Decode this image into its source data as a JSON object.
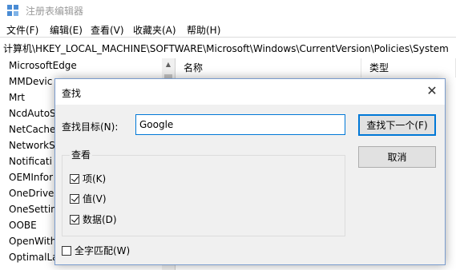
{
  "window": {
    "title": "注册表编辑器"
  },
  "menu": [
    "文件(F)",
    "编辑(E)",
    "查看(V)",
    "收藏夹(A)",
    "帮助(H)"
  ],
  "address": "计算机\\HKEY_LOCAL_MACHINE\\SOFTWARE\\Microsoft\\Windows\\CurrentVersion\\Policies\\System",
  "tree": {
    "items": [
      "MicrosoftEdge",
      "MMDevic",
      "Mrt",
      "NcdAutoS",
      "NetCache",
      "NetworkS",
      "Notificati",
      "OEMInfor",
      "OneDrive",
      "OneSettin",
      "OOBE",
      "OpenWith",
      "OptimalLa"
    ]
  },
  "values": {
    "columns": [
      "名称",
      "类型"
    ]
  },
  "dialog": {
    "title": "查找",
    "close_label": "✕",
    "find_label": "查找目标(N):",
    "find_value": "Google",
    "find_next_label": "查找下一个(F)",
    "cancel_label": "取消",
    "lookat_label": "查看",
    "checkboxes": [
      {
        "label": "项(K)",
        "checked": true
      },
      {
        "label": "值(V)",
        "checked": true
      },
      {
        "label": "数据(D)",
        "checked": true
      }
    ],
    "whole_string": {
      "label": "全字匹配(W)",
      "checked": false
    }
  },
  "colors": {
    "accent": "#0078d7",
    "button_bg": "#e1e1e1",
    "window_bg": "#f0f0f0"
  }
}
